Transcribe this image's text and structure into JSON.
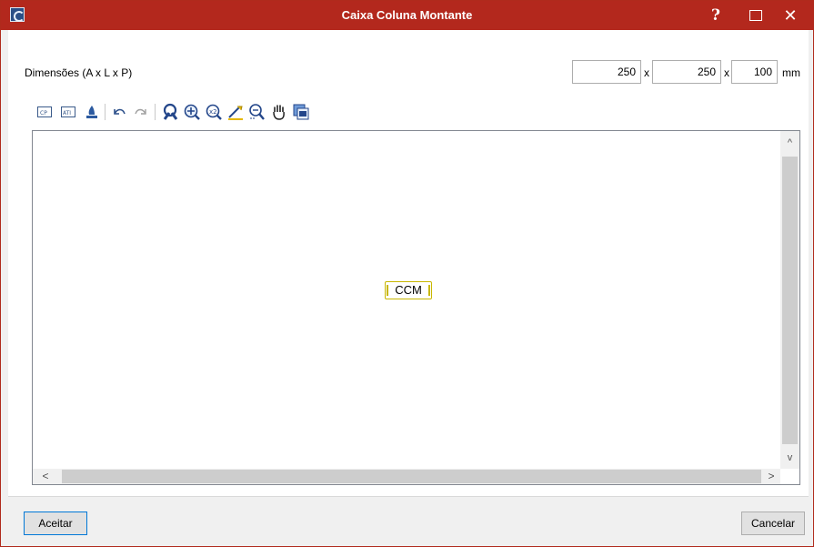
{
  "window": {
    "title": "Caixa Coluna Montante"
  },
  "titlebar": {
    "help": "?",
    "close": "✕"
  },
  "dimensions": {
    "label": "Dimensões (A x L x P)",
    "a": "250",
    "l": "250",
    "p": "100",
    "sep": "x",
    "unit": "mm"
  },
  "toolbar": {
    "tools": [
      "cp-icon",
      "ati-icon",
      "paint-icon",
      "undo-icon",
      "redo-icon",
      "select-icon",
      "zoom-window-icon",
      "zoom-in-icon",
      "measure-icon",
      "zoom-extents-icon",
      "pan-icon",
      "layers-icon"
    ]
  },
  "canvas": {
    "element_label": "CCM"
  },
  "scroll": {
    "up": "^",
    "down": "v",
    "left": "<",
    "right": ">"
  },
  "buttons": {
    "accept": "Aceitar",
    "cancel": "Cancelar"
  },
  "colors": {
    "titlebar": "#b3281d",
    "ccm_border": "#c8b700"
  }
}
